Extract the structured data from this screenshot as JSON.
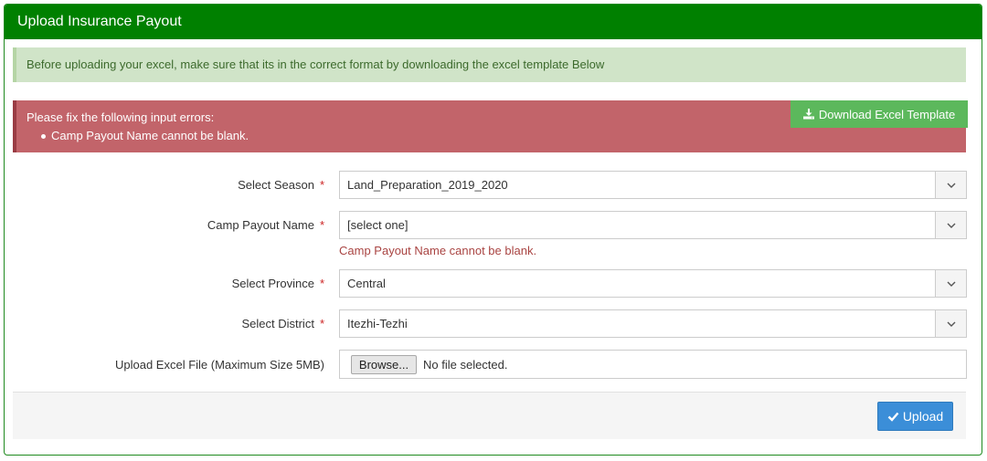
{
  "panel": {
    "title": "Upload Insurance Payout"
  },
  "info_alert": {
    "text": "Before uploading your excel, make sure that its in the correct format by downloading the excel template Below"
  },
  "error_alert": {
    "title": "Please fix the following input errors:",
    "items": [
      "Camp Payout Name cannot be blank."
    ]
  },
  "download_button": {
    "label": "Download Excel Template",
    "icon": "download-icon"
  },
  "form": {
    "required_marker": "*",
    "season": {
      "label": "Select Season",
      "value": "Land_Preparation_2019_2020"
    },
    "camp_payout": {
      "label": "Camp Payout Name",
      "value": "[select one]",
      "error": "Camp Payout Name cannot be blank."
    },
    "province": {
      "label": "Select Province",
      "value": "Central"
    },
    "district": {
      "label": "Select District",
      "value": "Itezhi-Tezhi"
    },
    "file": {
      "label": "Upload Excel File (Maximum Size 5MB)",
      "browse_label": "Browse...",
      "status": "No file selected."
    }
  },
  "footer": {
    "upload_label": "Upload",
    "upload_icon": "check-icon"
  },
  "colors": {
    "header_green": "#008000",
    "info_bg": "#d0e4c8",
    "error_bg": "#c2646a",
    "download_green": "#5cb85c",
    "upload_blue": "#3b8ed8",
    "error_text": "#a94442"
  }
}
